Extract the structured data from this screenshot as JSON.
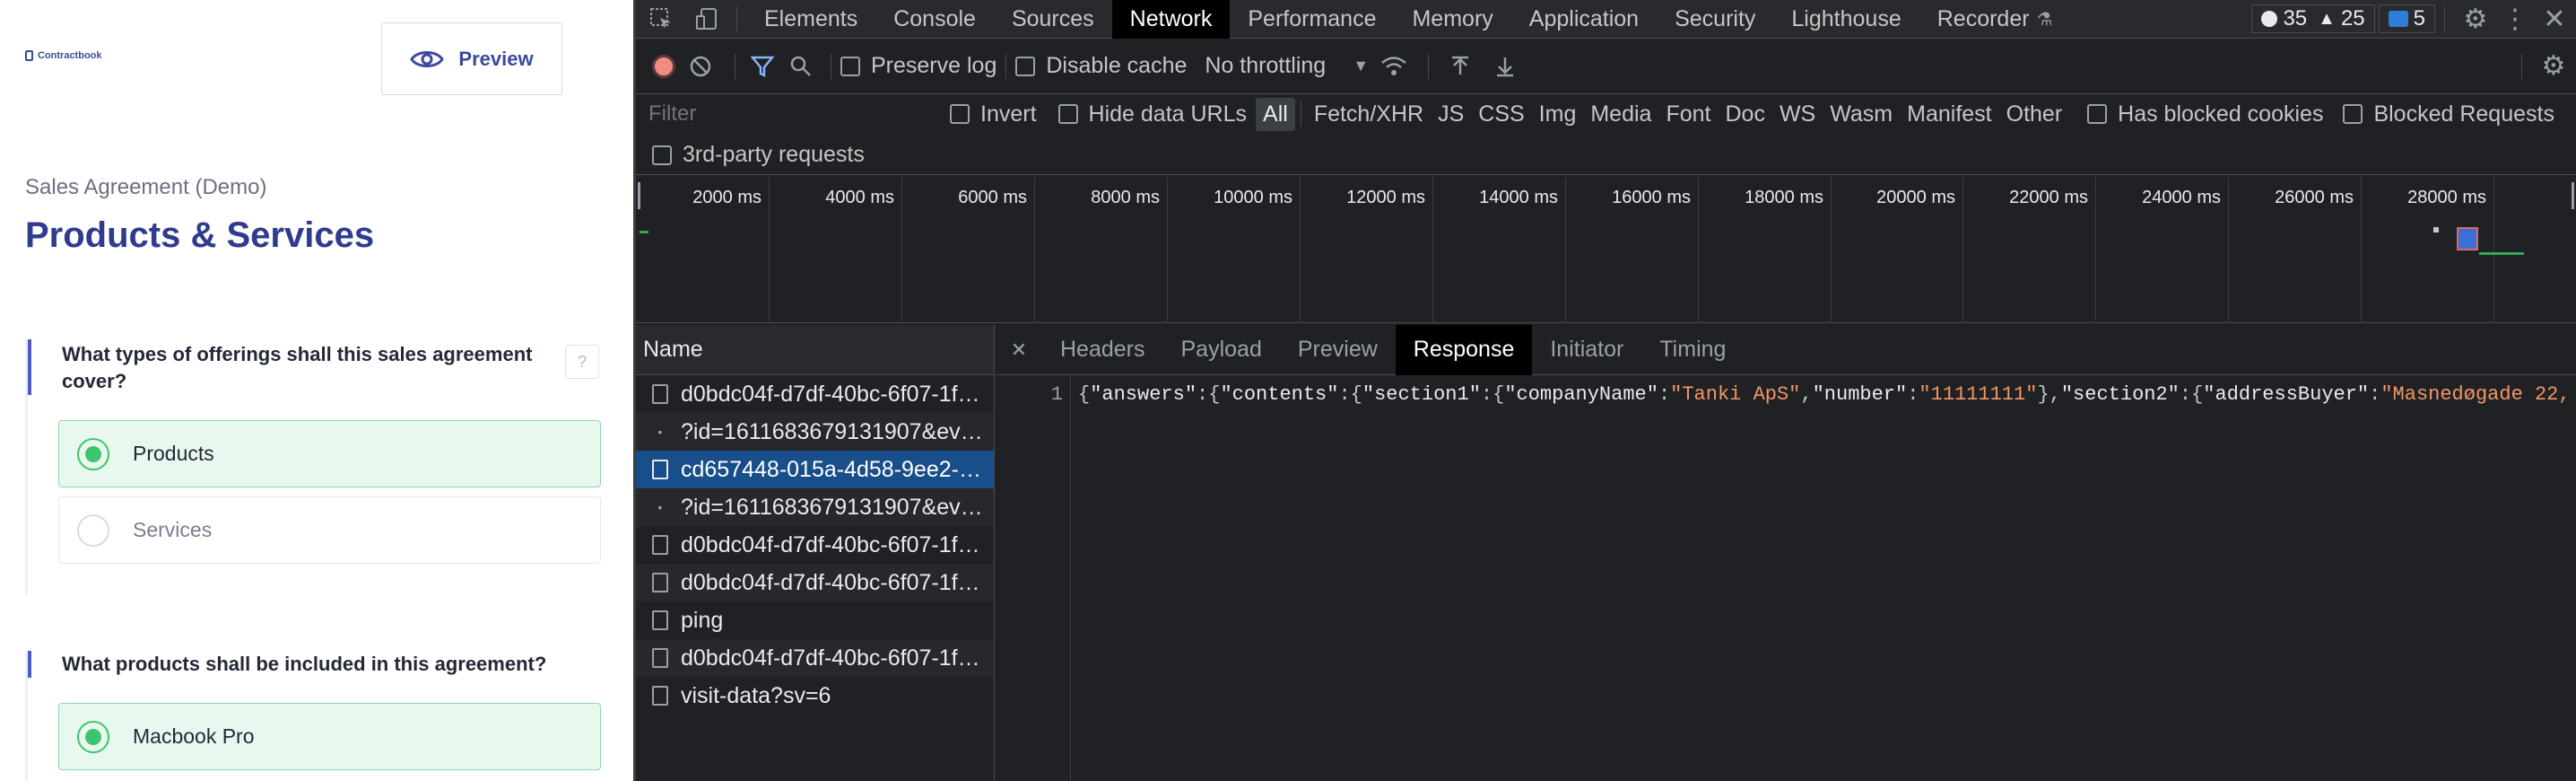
{
  "app": {
    "logo_text": "Contractbook",
    "preview_label": "Preview",
    "doc_subtitle": "Sales Agreement (Demo)",
    "section_title": "Products & Services",
    "help_label": "?",
    "questions": [
      {
        "text": "What types of offerings shall this sales agreement cover?",
        "options": [
          {
            "label": "Products",
            "selected": true
          },
          {
            "label": "Services",
            "selected": false
          }
        ]
      },
      {
        "text": "What products shall be included in this agreement?",
        "options": [
          {
            "label": "Macbook Pro",
            "selected": true
          }
        ]
      }
    ]
  },
  "devtools": {
    "tabs": [
      "Elements",
      "Console",
      "Sources",
      "Network",
      "Performance",
      "Memory",
      "Application",
      "Security",
      "Lighthouse",
      "Recorder"
    ],
    "active_tab": "Network",
    "counters": {
      "errors": "35",
      "warnings": "25",
      "messages": "5"
    },
    "toolbar": {
      "preserve_log": "Preserve log",
      "disable_cache": "Disable cache",
      "throttling": "No throttling"
    },
    "filter": {
      "placeholder": "Filter",
      "invert": "Invert",
      "hide_data_urls": "Hide data URLs",
      "types": [
        "All",
        "Fetch/XHR",
        "JS",
        "CSS",
        "Img",
        "Media",
        "Font",
        "Doc",
        "WS",
        "Wasm",
        "Manifest",
        "Other"
      ],
      "active_type": "All",
      "has_blocked_cookies": "Has blocked cookies",
      "blocked_requests": "Blocked Requests",
      "third_party": "3rd-party requests"
    },
    "timeline_ticks": [
      "2000 ms",
      "4000 ms",
      "6000 ms",
      "8000 ms",
      "10000 ms",
      "12000 ms",
      "14000 ms",
      "16000 ms",
      "18000 ms",
      "20000 ms",
      "22000 ms",
      "24000 ms",
      "26000 ms",
      "28000 ms"
    ],
    "name_header": "Name",
    "requests": [
      {
        "name": "d0bdc04f-d7df-40bc-6f07-1f…",
        "kind": "file",
        "selected": false
      },
      {
        "name": "?id=1611683679131907&ev…",
        "kind": "dot",
        "selected": false
      },
      {
        "name": "cd657448-015a-4d58-9ee2-…",
        "kind": "file",
        "selected": true
      },
      {
        "name": "?id=1611683679131907&ev…",
        "kind": "dot",
        "selected": false
      },
      {
        "name": "d0bdc04f-d7df-40bc-6f07-1f…",
        "kind": "file",
        "selected": false
      },
      {
        "name": "d0bdc04f-d7df-40bc-6f07-1f…",
        "kind": "file",
        "selected": false
      },
      {
        "name": "ping",
        "kind": "file",
        "selected": false
      },
      {
        "name": "d0bdc04f-d7df-40bc-6f07-1f…",
        "kind": "file",
        "selected": false
      },
      {
        "name": "visit-data?sv=6",
        "kind": "file",
        "selected": false
      }
    ],
    "detail_tabs": [
      "Headers",
      "Payload",
      "Preview",
      "Response",
      "Initiator",
      "Timing"
    ],
    "active_detail_tab": "Response",
    "response": {
      "line_number": "1",
      "tokens": [
        {
          "t": "p",
          "v": "{"
        },
        {
          "t": "k",
          "v": "\"answers\""
        },
        {
          "t": "p",
          "v": ":{"
        },
        {
          "t": "k",
          "v": "\"contents\""
        },
        {
          "t": "p",
          "v": ":{"
        },
        {
          "t": "k",
          "v": "\"section1\""
        },
        {
          "t": "p",
          "v": ":{"
        },
        {
          "t": "k",
          "v": "\"companyName\""
        },
        {
          "t": "p",
          "v": ":"
        },
        {
          "t": "s",
          "v": "\"Tanki ApS\""
        },
        {
          "t": "p",
          "v": ","
        },
        {
          "t": "k",
          "v": "\"number\""
        },
        {
          "t": "p",
          "v": ":"
        },
        {
          "t": "s",
          "v": "\"11111111\""
        },
        {
          "t": "p",
          "v": "},"
        },
        {
          "t": "k",
          "v": "\"section2\""
        },
        {
          "t": "p",
          "v": ":{"
        },
        {
          "t": "k",
          "v": "\"addressBuyer\""
        },
        {
          "t": "p",
          "v": ":"
        },
        {
          "t": "s",
          "v": "\"Masnedøgade 22,"
        }
      ]
    }
  }
}
